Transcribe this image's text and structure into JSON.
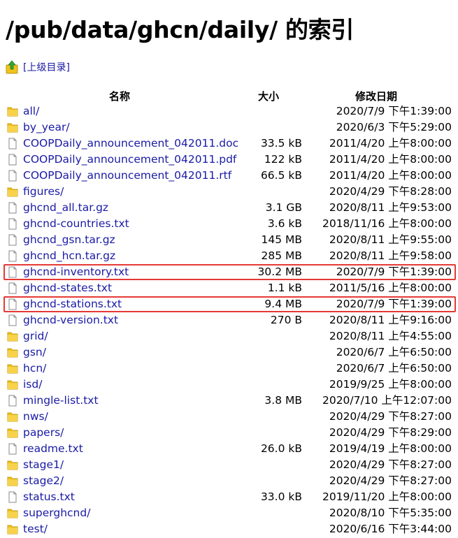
{
  "page": {
    "title": "/pub/data/ghcn/daily/ 的索引"
  },
  "parent": {
    "label": "[上级目录]",
    "icon": "up-folder-icon"
  },
  "columns": {
    "name": "名称",
    "size": "大小",
    "modified": "修改日期"
  },
  "colors": {
    "link": "#1a1aa6",
    "highlight": "#e53935",
    "folder": "#f0c419"
  },
  "entries": [
    {
      "name": "all/",
      "size": "",
      "date": "2020/7/9 下午1:39:00",
      "type": "folder",
      "highlighted": false
    },
    {
      "name": "by_year/",
      "size": "",
      "date": "2020/6/3 下午5:29:00",
      "type": "folder",
      "highlighted": false
    },
    {
      "name": "COOPDaily_announcement_042011.doc",
      "size": "33.5 kB",
      "date": "2011/4/20 上午8:00:00",
      "type": "file",
      "highlighted": false
    },
    {
      "name": "COOPDaily_announcement_042011.pdf",
      "size": "122 kB",
      "date": "2011/4/20 上午8:00:00",
      "type": "file",
      "highlighted": false
    },
    {
      "name": "COOPDaily_announcement_042011.rtf",
      "size": "66.5 kB",
      "date": "2011/4/20 上午8:00:00",
      "type": "file",
      "highlighted": false
    },
    {
      "name": "figures/",
      "size": "",
      "date": "2020/4/29 下午8:28:00",
      "type": "folder",
      "highlighted": false
    },
    {
      "name": "ghcnd_all.tar.gz",
      "size": "3.1 GB",
      "date": "2020/8/11 上午9:53:00",
      "type": "file",
      "highlighted": false
    },
    {
      "name": "ghcnd-countries.txt",
      "size": "3.6 kB",
      "date": "2018/11/16 上午8:00:00",
      "type": "file",
      "highlighted": false
    },
    {
      "name": "ghcnd_gsn.tar.gz",
      "size": "145 MB",
      "date": "2020/8/11 上午9:55:00",
      "type": "file",
      "highlighted": false
    },
    {
      "name": "ghcnd_hcn.tar.gz",
      "size": "285 MB",
      "date": "2020/8/11 上午9:58:00",
      "type": "file",
      "highlighted": false
    },
    {
      "name": "ghcnd-inventory.txt",
      "size": "30.2 MB",
      "date": "2020/7/9 下午1:39:00",
      "type": "file",
      "highlighted": true
    },
    {
      "name": "ghcnd-states.txt",
      "size": "1.1 kB",
      "date": "2011/5/16 上午8:00:00",
      "type": "file",
      "highlighted": false
    },
    {
      "name": "ghcnd-stations.txt",
      "size": "9.4 MB",
      "date": "2020/7/9 下午1:39:00",
      "type": "file",
      "highlighted": true
    },
    {
      "name": "ghcnd-version.txt",
      "size": "270 B",
      "date": "2020/8/11 上午9:16:00",
      "type": "file",
      "highlighted": false
    },
    {
      "name": "grid/",
      "size": "",
      "date": "2020/8/11 上午4:55:00",
      "type": "folder",
      "highlighted": false
    },
    {
      "name": "gsn/",
      "size": "",
      "date": "2020/6/7 上午6:50:00",
      "type": "folder",
      "highlighted": false
    },
    {
      "name": "hcn/",
      "size": "",
      "date": "2020/6/7 上午6:50:00",
      "type": "folder",
      "highlighted": false
    },
    {
      "name": "isd/",
      "size": "",
      "date": "2019/9/25 上午8:00:00",
      "type": "folder",
      "highlighted": false
    },
    {
      "name": "mingle-list.txt",
      "size": "3.8 MB",
      "date": "2020/7/10 上午12:07:00",
      "type": "file",
      "highlighted": false
    },
    {
      "name": "nws/",
      "size": "",
      "date": "2020/4/29 下午8:27:00",
      "type": "folder",
      "highlighted": false
    },
    {
      "name": "papers/",
      "size": "",
      "date": "2020/4/29 下午8:29:00",
      "type": "folder",
      "highlighted": false
    },
    {
      "name": "readme.txt",
      "size": "26.0 kB",
      "date": "2019/4/19 上午8:00:00",
      "type": "file",
      "highlighted": false
    },
    {
      "name": "stage1/",
      "size": "",
      "date": "2020/4/29 下午8:27:00",
      "type": "folder",
      "highlighted": false
    },
    {
      "name": "stage2/",
      "size": "",
      "date": "2020/4/29 下午8:27:00",
      "type": "folder",
      "highlighted": false
    },
    {
      "name": "status.txt",
      "size": "33.0 kB",
      "date": "2019/11/20 上午8:00:00",
      "type": "file",
      "highlighted": false
    },
    {
      "name": "superghcnd/",
      "size": "",
      "date": "2020/8/10 下午5:35:00",
      "type": "folder",
      "highlighted": false
    },
    {
      "name": "test/",
      "size": "",
      "date": "2020/6/16 下午3:44:00",
      "type": "folder",
      "highlighted": false
    }
  ]
}
